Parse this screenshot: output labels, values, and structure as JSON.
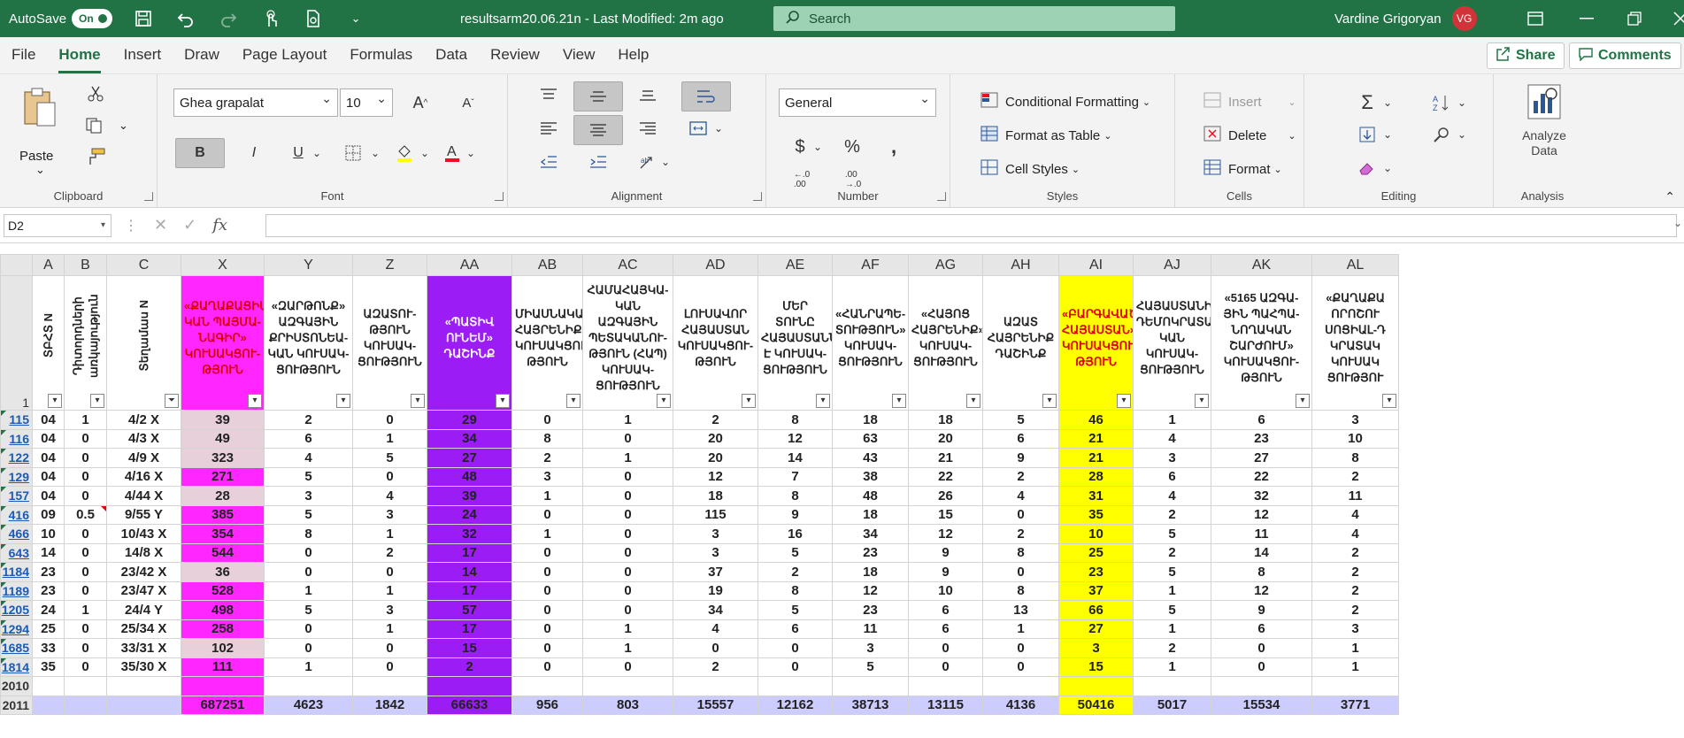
{
  "titlebar": {
    "autosave_label": "AutoSave",
    "autosave_state": "On",
    "file_title": "resultsarm20.06.21n  -  Last Modified: 2m ago",
    "search_placeholder": "Search",
    "user_name": "Vardine Grigoryan",
    "user_initials": "VG"
  },
  "menu": {
    "items": [
      "File",
      "Home",
      "Insert",
      "Draw",
      "Page Layout",
      "Formulas",
      "Data",
      "Review",
      "View",
      "Help"
    ],
    "active": "Home",
    "share_label": "Share",
    "comments_label": "Comments"
  },
  "ribbon": {
    "clipboard": {
      "label": "Clipboard",
      "paste": "Paste"
    },
    "font": {
      "label": "Font",
      "font_name": "Ghea grapalat",
      "font_size": "10"
    },
    "alignment": {
      "label": "Alignment"
    },
    "number": {
      "label": "Number",
      "format": "General"
    },
    "styles": {
      "label": "Styles",
      "conditional": "Conditional Formatting",
      "format_table": "Format as Table",
      "cell_styles": "Cell Styles"
    },
    "cells": {
      "label": "Cells",
      "insert": "Insert",
      "delete": "Delete",
      "format": "Format"
    },
    "editing": {
      "label": "Editing"
    },
    "analysis": {
      "label": "Analysis",
      "analyze": "Analyze Data"
    }
  },
  "formula_bar": {
    "name_box": "D2",
    "formula": ""
  },
  "columns": [
    "A",
    "B",
    "C",
    "X",
    "Y",
    "Z",
    "AA",
    "AB",
    "AC",
    "AD",
    "AE",
    "AF",
    "AG",
    "AH",
    "AI",
    "AJ",
    "AK",
    "AL"
  ],
  "header_row_num": "1",
  "headers": [
    "ՏԲՀՏ N",
    "Դիտորդների առկայություն",
    "Տեղամաս N",
    "«ՔԱՂԱՔԱՑԻԱ-ԿԱՆ ՊԱՅՄԱ-ՆԱԳԻՐ» ԿՈՒՍԱԿՑՈՒ-ԹՅՈՒՆ",
    "«ԶԱՐԹՈՆՔ» ԱԶԳԱՅԻՆ ՔՐԻՍՏՈՆԵԱ-ԿԱՆ ԿՈՒՍԱԿ-ՑՈՒԹՅՈՒՆ",
    "ԱԶԱՏՈՒ-ԹՅՈՒՆ ԿՈՒՍԱԿ-ՑՈՒԹՅՈՒՆ",
    "«ՊԱՏԻՎ ՈՒՆԵՄ» ԴԱՇԻՆՔ",
    "ՄԻԱՍՆԱԿԱՆ ՀԱՅՐԵՆԻՔ ԿՈՒՍԱԿՑՈՒ-ԹՅՈՒՆ",
    "ՀԱՄԱՀԱՅԿԱ-ԿԱՆ ԱԶԳԱՅԻՆ ՊԵՏԱԿԱՆՈՒ-ԹՅՈՒՆ (ՀԱՊ) ԿՈՒՍԱԿ-ՑՈՒԹՅՈՒՆ",
    "ԼՈՒՍԱՎՈՐ ՀԱՅԱՍՏԱՆ ԿՈՒՍԱԿՑՈՒ-ԹՅՈՒՆ",
    "ՄԵՐ ՏՈՒՆԸ ՀԱՅԱՍՏԱՆՆ Է ԿՈՒՍԱԿ-ՑՈՒԹՅՈՒՆ",
    "«ՀԱՆՐԱՊԵ-ՏՈՒԹՅՈՒՆ» ԿՈՒՍԱԿ-ՑՈՒԹՅՈՒՆ",
    "«ՀԱՅՈՑ ՀԱՅՐԵՆԻՔ» ԿՈՒՍԱԿ-ՑՈՒԹՅՈՒՆ",
    "ԱԶԱՏ ՀԱՅՐԵՆԻՔ ԴԱՇԻՆՔ",
    "«ԲԱՐԳԱՎԱԾ ՀԱՅԱՍՏԱՆ» ԿՈՒՍԱԿՑՈՒ-ԹՅՈՒՆ",
    "ՀԱՅԱՍՏԱՆԻ ԴԵՄՈԿՐԱՏԱ-ԿԱՆ ԿՈՒՍԱԿ-ՑՈՒԹՅՈՒՆ",
    "«5165 ԱԶԳԱ-ՅԻՆ ՊԱՀՊԱ-ՆՈՂԱԿԱՆ ՇԱՐԺՈՒՄ» ԿՈՒՍԱԿՑՈՒ-ԹՅՈՒՆ",
    "«ՔԱՂԱՔԱ ՈՐՈՇՈՒ ՍՈՑԻԱԼ-Դ ԿՐԱՏԱԿ ԿՈՒՍԱԿ ՑՈՒԹՅՈՒ"
  ],
  "rows": [
    {
      "num": "115",
      "cells": [
        "04",
        "1",
        "4/2 X",
        "39",
        "2",
        "0",
        "29",
        "0",
        "1",
        "2",
        "8",
        "18",
        "18",
        "5",
        "46",
        "1",
        "6",
        "3"
      ]
    },
    {
      "num": "116",
      "cells": [
        "04",
        "0",
        "4/3 X",
        "49",
        "6",
        "1",
        "34",
        "8",
        "0",
        "20",
        "12",
        "63",
        "20",
        "6",
        "21",
        "4",
        "23",
        "10"
      ]
    },
    {
      "num": "122",
      "cells": [
        "04",
        "0",
        "4/9 X",
        "323",
        "4",
        "5",
        "27",
        "2",
        "1",
        "20",
        "14",
        "43",
        "21",
        "9",
        "21",
        "3",
        "27",
        "8"
      ]
    },
    {
      "num": "129",
      "cells": [
        "04",
        "0",
        "4/16 X",
        "271",
        "5",
        "0",
        "48",
        "3",
        "0",
        "12",
        "7",
        "38",
        "22",
        "2",
        "28",
        "6",
        "22",
        "2"
      ]
    },
    {
      "num": "157",
      "cells": [
        "04",
        "0",
        "4/44 X",
        "28",
        "3",
        "4",
        "39",
        "1",
        "0",
        "18",
        "8",
        "48",
        "26",
        "4",
        "31",
        "4",
        "32",
        "11"
      ]
    },
    {
      "num": "416",
      "cells": [
        "09",
        "0.5",
        "9/55 Y",
        "385",
        "5",
        "3",
        "24",
        "0",
        "0",
        "115",
        "9",
        "18",
        "15",
        "0",
        "35",
        "2",
        "12",
        "4"
      ]
    },
    {
      "num": "466",
      "cells": [
        "10",
        "0",
        "10/43 X",
        "354",
        "8",
        "1",
        "32",
        "1",
        "0",
        "3",
        "16",
        "34",
        "12",
        "2",
        "10",
        "5",
        "11",
        "4"
      ]
    },
    {
      "num": "643",
      "cells": [
        "14",
        "0",
        "14/8 X",
        "544",
        "0",
        "2",
        "17",
        "0",
        "0",
        "3",
        "5",
        "23",
        "9",
        "8",
        "25",
        "2",
        "14",
        "2"
      ]
    },
    {
      "num": "1184",
      "cells": [
        "23",
        "0",
        "23/42 X",
        "36",
        "0",
        "0",
        "14",
        "0",
        "0",
        "37",
        "2",
        "18",
        "9",
        "0",
        "23",
        "5",
        "8",
        "2"
      ]
    },
    {
      "num": "1189",
      "cells": [
        "23",
        "0",
        "23/47 X",
        "528",
        "1",
        "1",
        "17",
        "0",
        "0",
        "19",
        "8",
        "12",
        "10",
        "8",
        "37",
        "1",
        "12",
        "2"
      ]
    },
    {
      "num": "1205",
      "cells": [
        "24",
        "1",
        "24/4 Y",
        "498",
        "5",
        "3",
        "57",
        "0",
        "0",
        "34",
        "5",
        "23",
        "6",
        "13",
        "66",
        "5",
        "9",
        "2"
      ]
    },
    {
      "num": "1294",
      "cells": [
        "25",
        "0",
        "25/34 X",
        "258",
        "0",
        "1",
        "17",
        "0",
        "1",
        "4",
        "6",
        "11",
        "6",
        "1",
        "27",
        "1",
        "6",
        "3"
      ]
    },
    {
      "num": "1685",
      "cells": [
        "33",
        "0",
        "33/31 X",
        "102",
        "0",
        "0",
        "15",
        "0",
        "1",
        "0",
        "0",
        "3",
        "0",
        "0",
        "3",
        "2",
        "0",
        "1"
      ]
    },
    {
      "num": "1814",
      "cells": [
        "35",
        "0",
        "35/30 X",
        "111",
        "1",
        "0",
        "2",
        "0",
        "0",
        "2",
        "0",
        "5",
        "0",
        "0",
        "15",
        "1",
        "0",
        "1"
      ]
    },
    {
      "num": "2010",
      "cells": [
        "",
        "",
        "",
        "",
        "",
        "",
        "",
        "",
        "",
        "",
        "",
        "",
        "",
        "",
        "",
        "",
        "",
        ""
      ]
    },
    {
      "num": "2011",
      "cells": [
        "",
        "",
        "",
        "687251",
        "4623",
        "1842",
        "66633",
        "956",
        "803",
        "15557",
        "12162",
        "38713",
        "13115",
        "4136",
        "50416",
        "5017",
        "15534",
        "3771"
      ]
    }
  ],
  "highlight_colors": {
    "x_pink": "#e8d0db",
    "x_magenta": "#ff26ff",
    "aa_purple": "#9b1cf5",
    "ai_yellow": "#ffff00",
    "total_row": "#ccccff"
  }
}
